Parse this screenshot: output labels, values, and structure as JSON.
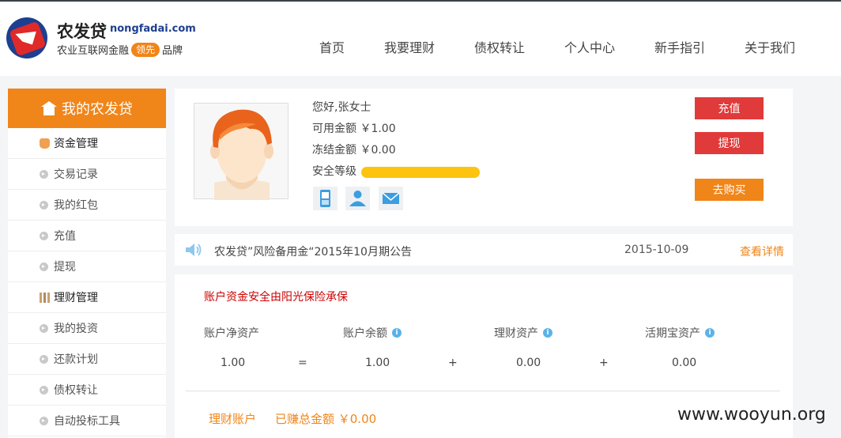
{
  "brand": {
    "name": "农发贷",
    "domain": "nongfadai.com",
    "slogan_prefix": "农业互联网金融",
    "slogan_badge": "领先",
    "slogan_suffix": "品牌"
  },
  "nav": [
    "首页",
    "我要理财",
    "债权转让",
    "个人中心",
    "新手指引",
    "关于我们"
  ],
  "sidebar": {
    "title": "我的农发贷",
    "items": [
      {
        "label": "资金管理",
        "type": "group"
      },
      {
        "label": "交易记录",
        "type": "item"
      },
      {
        "label": "我的红包",
        "type": "item"
      },
      {
        "label": "充值",
        "type": "item"
      },
      {
        "label": "提现",
        "type": "item"
      },
      {
        "label": "理财管理",
        "type": "group"
      },
      {
        "label": "我的投资",
        "type": "item"
      },
      {
        "label": "还款计划",
        "type": "item"
      },
      {
        "label": "债权转让",
        "type": "item"
      },
      {
        "label": "自动投标工具",
        "type": "item"
      }
    ]
  },
  "user": {
    "greeting": "您好,张女士",
    "available": "可用金额 ￥1.00",
    "frozen": "冻结金额 ￥0.00",
    "security_label": "安全等级",
    "security_level": 1.0,
    "security_color": "#fcc40f"
  },
  "actions": {
    "recharge": "充值",
    "withdraw": "提现",
    "buy": "去购买"
  },
  "notice": {
    "text": "农发贷”风险备用金“2015年10月期公告",
    "date": "2015-10-09",
    "link": "查看详情"
  },
  "assets": {
    "warning": "账户资金安全由阳光保险承保",
    "net_label": "账户净资产",
    "balance_label": "账户余额",
    "finance_label": "理财资产",
    "current_label": "活期宝资产",
    "net_value": "1.00",
    "balance_value": "1.00",
    "finance_value": "0.00",
    "current_value": "0.00",
    "eq": "=",
    "plus": "+",
    "account_label": "理财账户",
    "earned_label": "已赚总金额 ￥0.00",
    "info_glyph": "i"
  },
  "watermark": "www.wooyun.org",
  "colors": {
    "accent": "#f08519",
    "danger": "#e03a3a",
    "brand_blue": "#1d3f8f"
  }
}
